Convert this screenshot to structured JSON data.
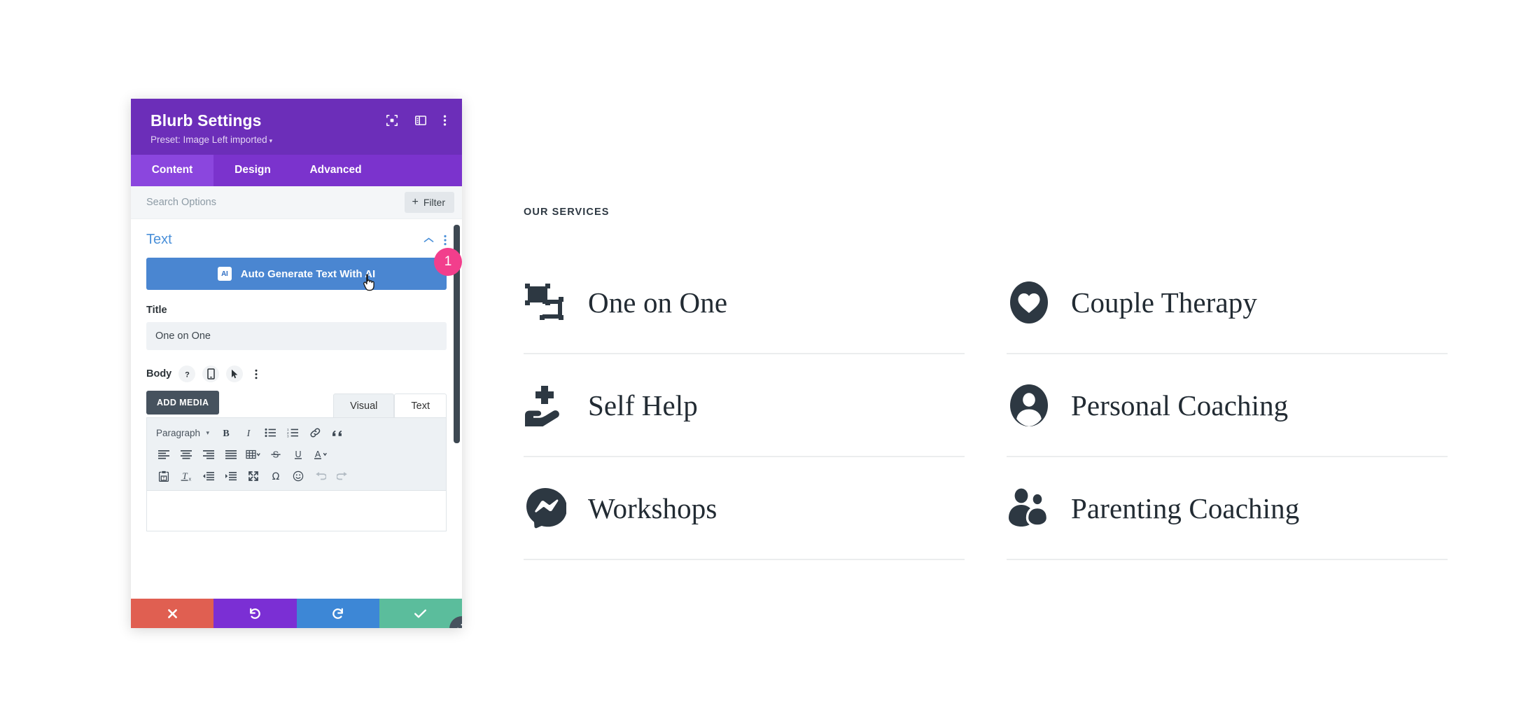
{
  "modal": {
    "title": "Blurb Settings",
    "preset_label": "Preset: Image Left imported",
    "preset_caret": "▾",
    "header_icons": [
      {
        "name": "focus-icon",
        "label": "Focus"
      },
      {
        "name": "layout-panel-icon",
        "label": "Layout"
      },
      {
        "name": "more-vertical-icon",
        "label": "More options"
      }
    ],
    "tabs": [
      {
        "label": "Content",
        "active": true
      },
      {
        "label": "Design",
        "active": false
      },
      {
        "label": "Advanced",
        "active": false
      }
    ],
    "search": {
      "placeholder": "Search Options",
      "value": ""
    },
    "filter_button": {
      "plus": "+",
      "label": "Filter"
    },
    "section": {
      "title": "Text",
      "collapse_icon": "chevron-up",
      "menu_icon": "more-vertical"
    },
    "ai_button": {
      "badge_text": "AI",
      "label": "Auto Generate Text With AI"
    },
    "step_badge": "1",
    "title_field": {
      "label": "Title",
      "value": "One on One",
      "placeholder": ""
    },
    "body_field": {
      "label": "Body",
      "icons": [
        {
          "name": "help-icon",
          "glyph": "?"
        },
        {
          "name": "responsive-mobile-icon",
          "glyph": "mobile"
        },
        {
          "name": "hover-cursor-icon",
          "glyph": "cursor"
        },
        {
          "name": "more-vertical-icon",
          "glyph": "dots"
        }
      ]
    },
    "editor": {
      "add_media_label": "ADD MEDIA",
      "tabs": [
        {
          "label": "Visual",
          "active": true
        },
        {
          "label": "Text",
          "active": false
        }
      ],
      "format_select": "Paragraph",
      "toolbar_row1": [
        {
          "name": "bold-icon",
          "label": "Bold"
        },
        {
          "name": "italic-icon",
          "label": "Italic"
        },
        {
          "name": "bulleted-list-icon",
          "label": "Bulleted list"
        },
        {
          "name": "numbered-list-icon",
          "label": "Numbered list"
        },
        {
          "name": "link-icon",
          "label": "Insert link"
        },
        {
          "name": "blockquote-icon",
          "label": "Blockquote"
        }
      ],
      "toolbar_row2": [
        {
          "name": "align-left-icon",
          "label": "Align left"
        },
        {
          "name": "align-center-icon",
          "label": "Align center"
        },
        {
          "name": "align-right-icon",
          "label": "Align right"
        },
        {
          "name": "align-justify-icon",
          "label": "Justify"
        },
        {
          "name": "table-icon",
          "label": "Table"
        },
        {
          "name": "strikethrough-icon",
          "label": "Strikethrough"
        },
        {
          "name": "underline-icon",
          "label": "Underline"
        },
        {
          "name": "text-color-icon",
          "label": "Text color"
        }
      ],
      "toolbar_row3": [
        {
          "name": "paste-as-text-icon",
          "label": "Paste as text"
        },
        {
          "name": "clear-formatting-icon",
          "label": "Clear formatting"
        },
        {
          "name": "outdent-icon",
          "label": "Decrease indent"
        },
        {
          "name": "indent-icon",
          "label": "Increase indent"
        },
        {
          "name": "fullscreen-icon",
          "label": "Fullscreen"
        },
        {
          "name": "special-character-icon",
          "label": "Special character"
        },
        {
          "name": "emoji-icon",
          "label": "Emoji"
        },
        {
          "name": "undo-icon",
          "label": "Undo"
        },
        {
          "name": "redo-icon",
          "label": "Redo"
        }
      ],
      "content": ""
    },
    "footer_buttons": [
      {
        "name": "cancel-button",
        "icon": "close",
        "color": "#e05f51"
      },
      {
        "name": "undo-button",
        "icon": "undo",
        "color": "#7b2fd4"
      },
      {
        "name": "redo-button",
        "icon": "redo",
        "color": "#3d87d6"
      },
      {
        "name": "save-button",
        "icon": "check",
        "color": "#5bbd9c"
      }
    ],
    "resize_handle_icon": "resize-diagonal"
  },
  "services": {
    "eyebrow": "OUR SERVICES",
    "items": [
      {
        "label": "One on One",
        "icon": "two-frames-icon"
      },
      {
        "label": "Couple Therapy",
        "icon": "heart-in-circle-icon"
      },
      {
        "label": "Self Help",
        "icon": "hand-holding-plus-icon"
      },
      {
        "label": "Personal Coaching",
        "icon": "person-in-circle-icon"
      },
      {
        "label": "Workshops",
        "icon": "messenger-bubble-icon"
      },
      {
        "label": "Parenting Coaching",
        "icon": "two-people-icon"
      }
    ]
  },
  "colors": {
    "modal_header": "#6c2eb9",
    "modal_tabbar": "#7b33cd",
    "modal_tab_active": "#8b46de",
    "ai_button": "#4a86d1",
    "step_badge": "#f23e8c",
    "section_title": "#4a90d9",
    "icon_dark": "#2d3842",
    "cancel": "#e05f51",
    "undo": "#7b2fd4",
    "redo": "#3d87d6",
    "save": "#5bbd9c"
  }
}
